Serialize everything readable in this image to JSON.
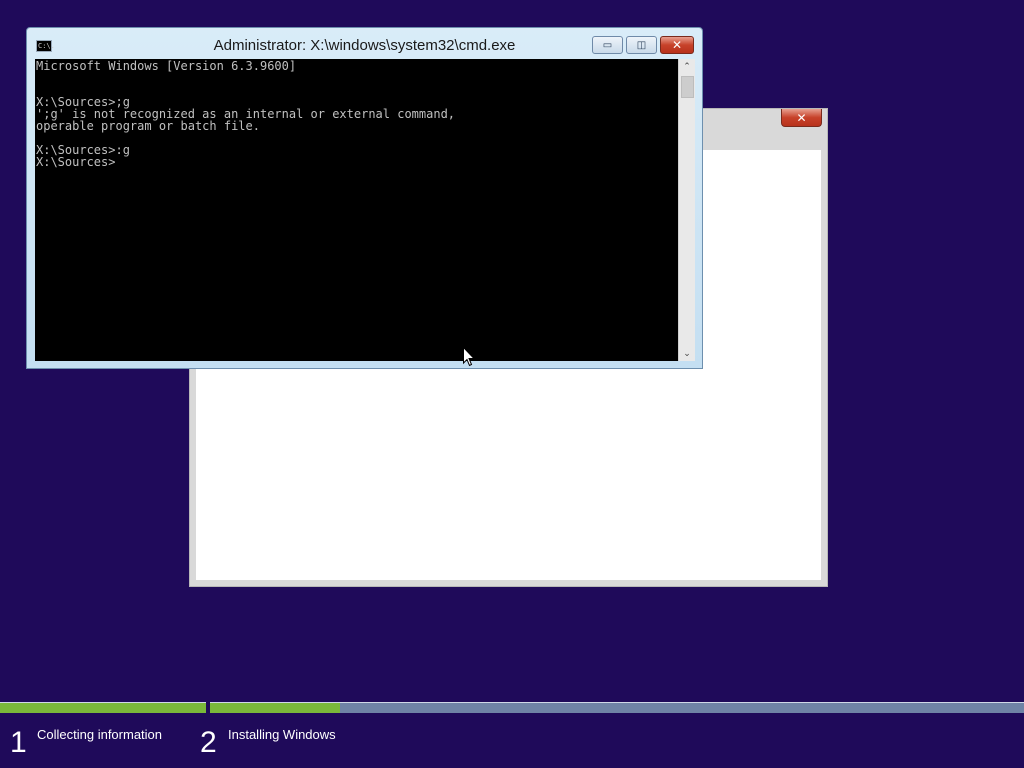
{
  "background_color": "#1f0a5a",
  "setup_window": {
    "close_label": "✕"
  },
  "cmd": {
    "icon_text": "C:\\.",
    "title": "Administrator: X:\\windows\\system32\\cmd.exe",
    "minimize_label": "▭",
    "maximize_label": "◫",
    "close_label": "✕",
    "console_text": "Microsoft Windows [Version 6.3.9600]\n\n\nX:\\Sources>;g\n';g' is not recognized as an internal or external command,\noperable program or batch file.\n\nX:\\Sources>:g\nX:\\Sources>",
    "scroll_up_label": "⌃",
    "scroll_down_label": "⌄"
  },
  "progress": {
    "steps": [
      {
        "number": "1",
        "label": "Collecting information",
        "fill": 1.0
      },
      {
        "number": "2",
        "label": "Installing Windows",
        "fill": 0.16
      }
    ],
    "accent": "#7ab83a",
    "track": "#6f83a6"
  }
}
